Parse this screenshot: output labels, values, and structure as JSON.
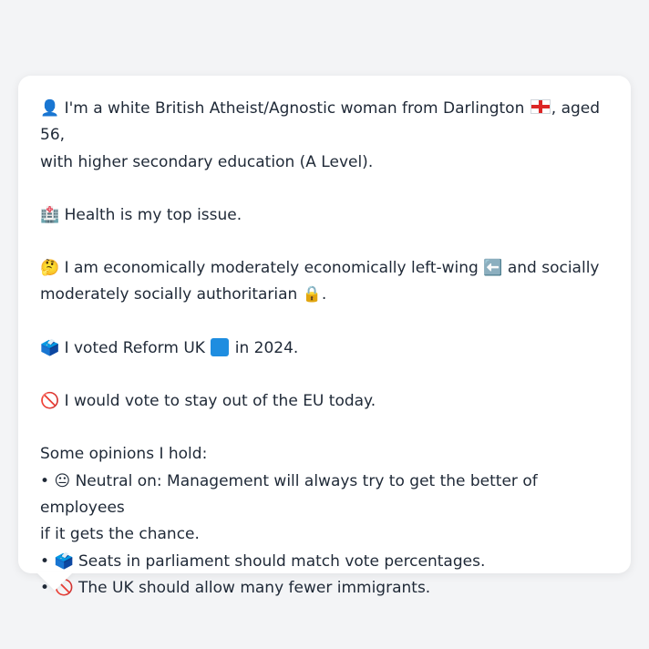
{
  "intro": {
    "emoji": "👤",
    "text_before_flag": "I'm a white British Atheist/Agnostic woman from Darlington",
    "flag_name": "england-flag",
    "text_after_flag": ", aged 56,",
    "line2": "with higher secondary education (A Level)."
  },
  "issue": {
    "emoji": "🏥",
    "text": "Health is my top issue."
  },
  "politics": {
    "emoji": "🤔",
    "line1_before_icon": "I am economically moderately economically left-wing",
    "line1_icon": "⬅️",
    "line1_after_icon": "and socially",
    "line2_before_icon": "moderately socially authoritarian",
    "line2_icon": "🔒",
    "line2_after_icon": "."
  },
  "vote": {
    "emoji": "🗳️",
    "text_before": "I voted Reform UK",
    "party_color": "#1e8de0",
    "text_after": "in 2024."
  },
  "eu": {
    "emoji": "🚫",
    "text": "I would vote to stay out of the EU today."
  },
  "opinions": {
    "heading": "Some opinions I hold:",
    "bullet": "•",
    "items": [
      {
        "emoji": "😐",
        "line1": "Neutral on: Management will always try to get the better of employees",
        "line2": "if it gets the chance."
      },
      {
        "emoji": "🗳️",
        "line1": "Seats in parliament should match vote percentages."
      },
      {
        "emoji": "🚫",
        "line1": "The UK should allow many fewer immigrants."
      }
    ]
  }
}
